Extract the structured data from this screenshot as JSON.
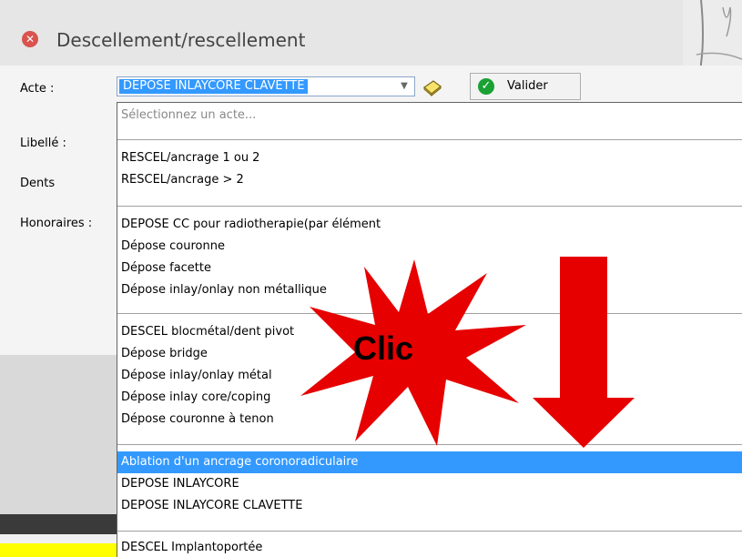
{
  "window": {
    "title": "Descellement/rescellement"
  },
  "form": {
    "acte_label": "Acte :",
    "libelle_label": "Libellé :",
    "dents_label": "Dents",
    "honoraires_label": "Honoraires :",
    "acte_selected": "DEPOSE INLAYCORE CLAVETTE",
    "valider_label": "Valider"
  },
  "dropdown": {
    "placeholder": "Sélectionnez un acte...",
    "groups": [
      [
        "RESCEL/ancrage 1 ou 2",
        "RESCEL/ancrage > 2"
      ],
      [
        "DEPOSE CC pour radiotherapie(par élément",
        "Dépose couronne",
        "Dépose facette",
        "Dépose inlay/onlay non métallique"
      ],
      [
        "DESCEL blocmétal/dent pivot",
        "Dépose bridge",
        "Dépose inlay/onlay métal",
        "Dépose inlay core/coping",
        "Dépose couronne à tenon"
      ],
      [
        "Ablation d'un ancrage coronoradiculaire",
        "DEPOSE INLAYCORE",
        "DEPOSE INLAYCORE CLAVETTE"
      ],
      [
        "DESCEL Implantoportée"
      ]
    ],
    "highlighted": "Ablation d'un ancrage coronoradiculaire"
  },
  "overlay": {
    "clic_text": "Clic"
  },
  "colors": {
    "selection": "#3399ff",
    "annotation_red": "#e60000",
    "title_icon": "#d9534f",
    "check_green": "#1aa133"
  }
}
